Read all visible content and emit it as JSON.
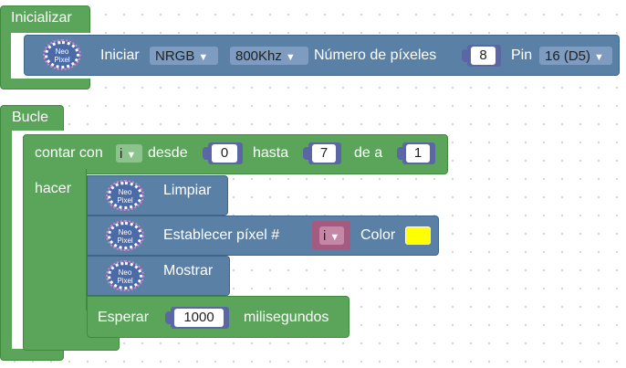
{
  "inicializar": {
    "label": "Inicializar",
    "block": {
      "iniciar_label": "Iniciar",
      "type_value": "NRGB",
      "freq_value": "800Khz",
      "pixels_label": "Número de píxeles",
      "pixels_value": "8",
      "pin_label": "Pin",
      "pin_value": "16 (D5)"
    }
  },
  "bucle": {
    "label": "Bucle",
    "loop": {
      "count_label": "contar con",
      "var": "i",
      "from_label": "desde",
      "from_value": "0",
      "to_label": "hasta",
      "to_value": "7",
      "step_label": "de a",
      "step_value": "1",
      "do_label": "hacer"
    },
    "clear_label": "Limpiar",
    "setpixel_label": "Establecer píxel #",
    "setpixel_var": "i",
    "color_label": "Color",
    "color_hex": "#ffff00",
    "show_label": "Mostrar",
    "wait_label": "Esperar",
    "wait_value": "1000",
    "wait_unit": "milisegundos"
  },
  "neopixel_icon": {
    "line1": "Neo",
    "line2": "Pixel"
  },
  "colors": {
    "control": "#5ba55b",
    "neopixel": "#5b80a5",
    "math": "#5b67a5",
    "variable": "#a55b80"
  }
}
